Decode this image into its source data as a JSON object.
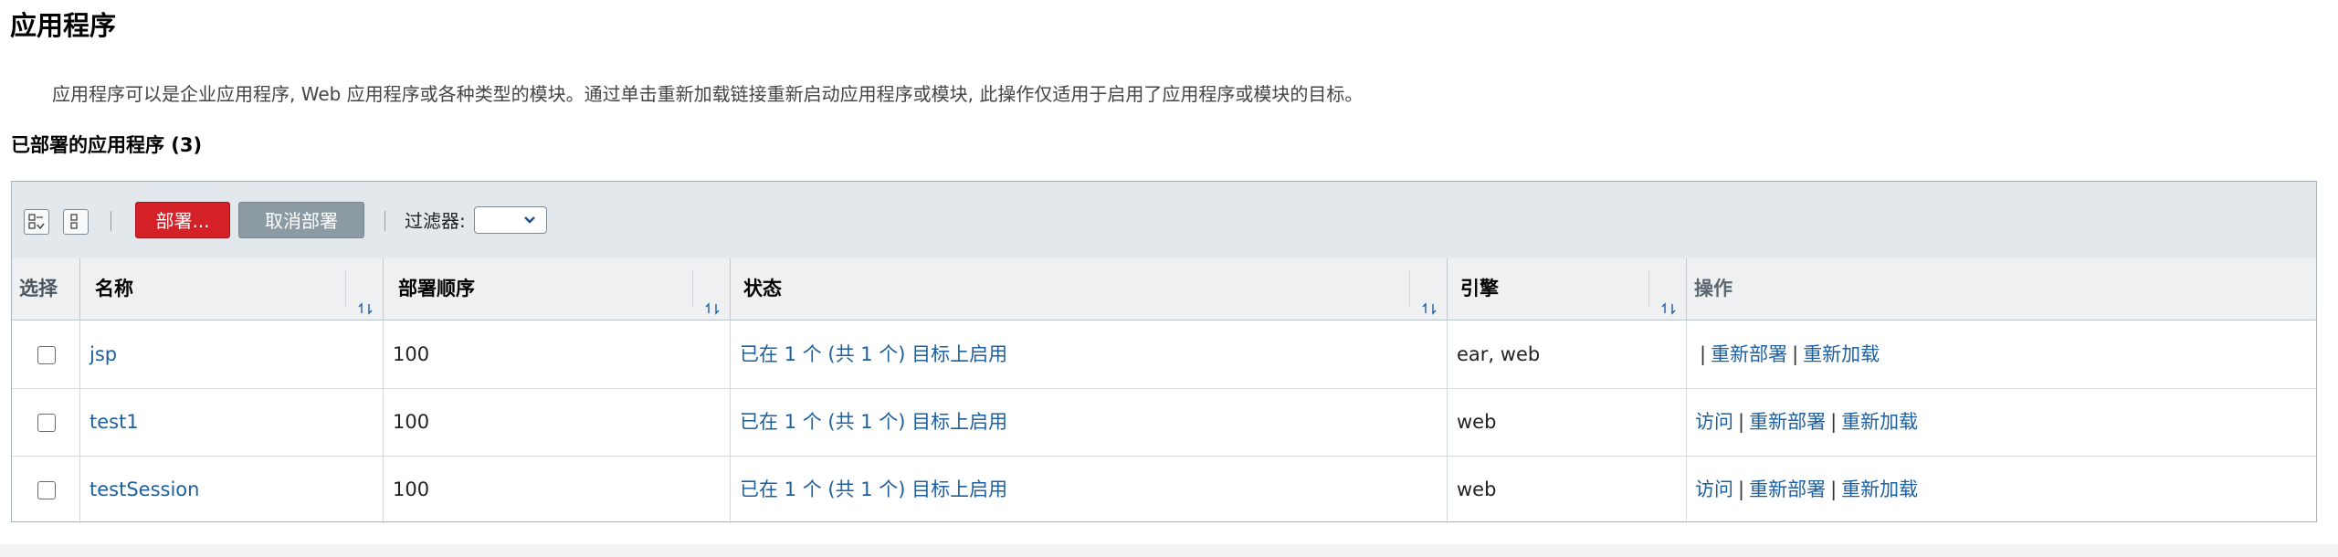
{
  "page": {
    "title": "应用程序",
    "description": "应用程序可以是企业应用程序, Web 应用程序或各种类型的模块。通过单击重新加载链接重新启动应用程序或模块, 此操作仅适用于启用了应用程序或模块的目标。",
    "section_title": "已部署的应用程序 (3)"
  },
  "toolbar": {
    "select_all_icon": "select-all-icon",
    "deselect_all_icon": "deselect-all-icon",
    "deploy_label": "部署...",
    "undeploy_label": "取消部署",
    "filter_label": "过滤器:",
    "filter_value": ""
  },
  "colors": {
    "deploy_button": "#d42027",
    "undeploy_button": "#8c9aa3",
    "link": "#1e5fa0",
    "toolbar_bg": "#e3e8ec"
  },
  "table": {
    "headers": {
      "select": "选择",
      "name": "名称",
      "order": "部署顺序",
      "status": "状态",
      "engine": "引擎",
      "actions": "操作"
    },
    "sort_icon": "sort-toggle-icon",
    "rows": [
      {
        "name": "jsp",
        "order": "100",
        "status": "已在 1 个 (共 1 个) 目标上启用",
        "engine": "ear, web",
        "visit": "",
        "redeploy": "重新部署",
        "reload": "重新加载"
      },
      {
        "name": "test1",
        "order": "100",
        "status": "已在 1 个 (共 1 个) 目标上启用",
        "engine": "web",
        "visit": "访问",
        "redeploy": "重新部署",
        "reload": "重新加载"
      },
      {
        "name": "testSession",
        "order": "100",
        "status": "已在 1 个 (共 1 个) 目标上启用",
        "engine": "web",
        "visit": "访问",
        "redeploy": "重新部署",
        "reload": "重新加载"
      }
    ]
  }
}
